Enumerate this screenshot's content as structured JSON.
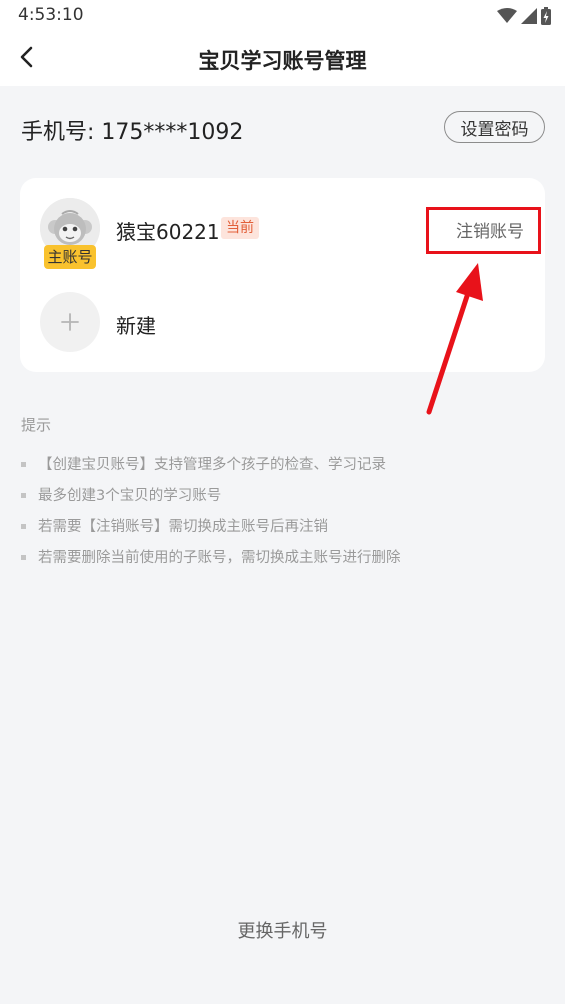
{
  "status_bar": {
    "time": "4:53:10",
    "icons": [
      "wifi-icon",
      "signal-icon",
      "battery-charging-icon"
    ]
  },
  "nav": {
    "title": "宝贝学习账号管理",
    "back_icon": "chevron-left-icon"
  },
  "phone": {
    "label": "手机号: 175****1092",
    "set_password_label": "设置密码"
  },
  "accounts": [
    {
      "name": "猿宝60221",
      "badge": "主账号",
      "current_tag": "当前",
      "action_label": "注销账号",
      "avatar_icon": "monkey-avatar-icon"
    }
  ],
  "new_account": {
    "label": "新建",
    "icon": "plus-icon"
  },
  "annotation": {
    "highlight_color": "#e8121a"
  },
  "tips": {
    "title": "提示",
    "items": [
      "【创建宝贝账号】支持管理多个孩子的检查、学习记录",
      "最多创建3个宝贝的学习账号",
      "若需要【注销账号】需切换成主账号后再注销",
      "若需要删除当前使用的子账号，需切换成主账号进行删除"
    ]
  },
  "footer": {
    "change_phone_label": "更换手机号"
  },
  "colors": {
    "background": "#f4f5f7",
    "badge_yellow": "#f9c22e",
    "current_tag_bg": "#fde4dc",
    "current_tag_text": "#e2603a"
  }
}
